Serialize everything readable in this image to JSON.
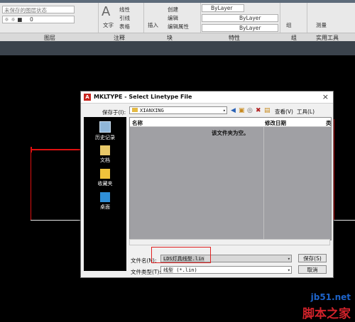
{
  "ribbon": {
    "layer_state": "未保存的图层状态",
    "layer_number": "0",
    "text_label": "文字",
    "linear_label": "线性",
    "leader_label": "引线",
    "table_label": "表格",
    "insert_label": "插入",
    "create_label": "创建",
    "edit_label": "编辑",
    "edit_attrib_label": "编辑属性",
    "bylayer_1": "ByLayer",
    "bylayer_2": "ByLayer",
    "bylayer_3": "ByLayer",
    "group_label": "组",
    "measure_label": "测量",
    "panels": [
      "图层",
      "注释",
      "块",
      "特性",
      "组",
      "实用工具"
    ]
  },
  "dialog": {
    "title": "MKLTYPE - Select Linetype File",
    "close_glyph": "×",
    "save_in_label": "保存于(I):",
    "save_in_value": "XIANXING",
    "view_label": "查看(V)",
    "tools_label": "工具(L)",
    "places": [
      {
        "label": "历史记录",
        "icon": "history-icon"
      },
      {
        "label": "文档",
        "icon": "documents-icon"
      },
      {
        "label": "收藏夹",
        "icon": "favorites-icon"
      },
      {
        "label": "桌面",
        "icon": "desktop-icon"
      }
    ],
    "columns": {
      "name": "名称",
      "modified": "修改日期",
      "extra": "类"
    },
    "empty_message": "该文件夹为空。",
    "filename_label": "文件名(N):",
    "filename_value": "LDS灯具线型.lin",
    "filetype_label": "文件类型(T):",
    "filetype_value": "线型 (*.lin)",
    "save_button": "保存(S)",
    "cancel_button": "取消"
  },
  "watermark": {
    "site": "jb51.net",
    "name": "脚本之家"
  },
  "colors": {
    "accent_red": "#e01010",
    "watermark_blue": "#1d63c9"
  }
}
